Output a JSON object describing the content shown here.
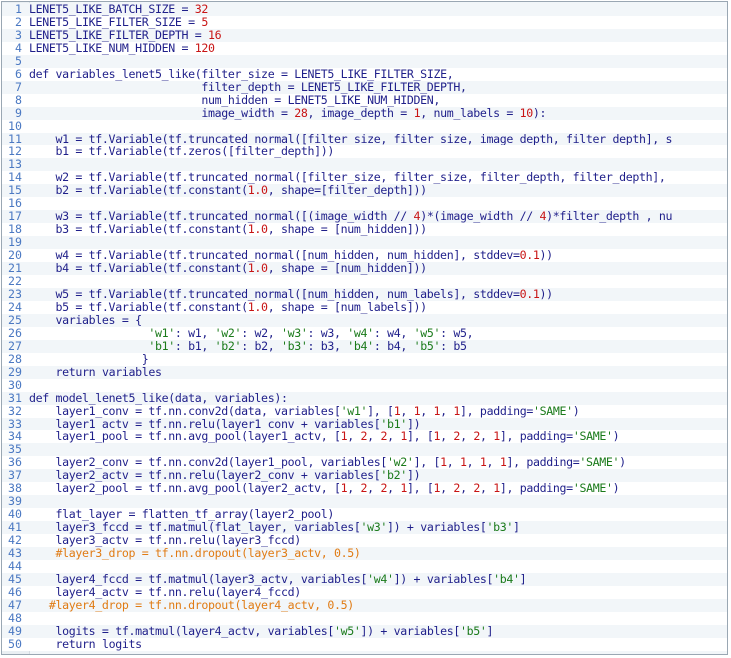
{
  "editor": {
    "lines": [
      {
        "n": "1",
        "tokens": [
          [
            "plain",
            "LENET5_LIKE_BATCH_SIZE = "
          ],
          [
            "num",
            "32"
          ]
        ]
      },
      {
        "n": "2",
        "tokens": [
          [
            "plain",
            "LENET5_LIKE_FILTER_SIZE = "
          ],
          [
            "num",
            "5"
          ]
        ]
      },
      {
        "n": "3",
        "tokens": [
          [
            "plain",
            "LENET5_LIKE_FILTER_DEPTH = "
          ],
          [
            "num",
            "16"
          ]
        ]
      },
      {
        "n": "4",
        "tokens": [
          [
            "plain",
            "LENET5_LIKE_NUM_HIDDEN = "
          ],
          [
            "num",
            "120"
          ]
        ]
      },
      {
        "n": "5",
        "tokens": []
      },
      {
        "n": "6",
        "tokens": [
          [
            "kw",
            "def "
          ],
          [
            "plain",
            "variables_lenet5_like(filter_size = LENET5_LIKE_FILTER_SIZE,"
          ]
        ]
      },
      {
        "n": "7",
        "tokens": [
          [
            "plain",
            "                          filter_depth = LENET5_LIKE_FILTER_DEPTH,"
          ]
        ]
      },
      {
        "n": "8",
        "tokens": [
          [
            "plain",
            "                          num_hidden = LENET5_LIKE_NUM_HIDDEN,"
          ]
        ]
      },
      {
        "n": "9",
        "tokens": [
          [
            "plain",
            "                          image_width = "
          ],
          [
            "num",
            "28"
          ],
          [
            "plain",
            ", image_depth = "
          ],
          [
            "num",
            "1"
          ],
          [
            "plain",
            ", num_labels = "
          ],
          [
            "num",
            "10"
          ],
          [
            "plain",
            "):"
          ]
        ]
      },
      {
        "n": "10",
        "tokens": []
      },
      {
        "n": "11",
        "tokens": [
          [
            "plain",
            "    w1 = tf.Variable(tf.truncated_normal([filter_size, filter_size, image_depth, filter_depth], s"
          ]
        ]
      },
      {
        "n": "12",
        "tokens": [
          [
            "plain",
            "    b1 = tf.Variable(tf.zeros([filter_depth]))"
          ]
        ]
      },
      {
        "n": "13",
        "tokens": []
      },
      {
        "n": "14",
        "tokens": [
          [
            "plain",
            "    w2 = tf.Variable(tf.truncated_normal([filter_size, filter_size, filter_depth, filter_depth], "
          ]
        ]
      },
      {
        "n": "15",
        "tokens": [
          [
            "plain",
            "    b2 = tf.Variable(tf.constant("
          ],
          [
            "num",
            "1.0"
          ],
          [
            "plain",
            ", shape=[filter_depth]))"
          ]
        ]
      },
      {
        "n": "16",
        "tokens": []
      },
      {
        "n": "17",
        "tokens": [
          [
            "plain",
            "    w3 = tf.Variable(tf.truncated_normal([(image_width // "
          ],
          [
            "num",
            "4"
          ],
          [
            "plain",
            ")*(image_width // "
          ],
          [
            "num",
            "4"
          ],
          [
            "plain",
            ")*filter_depth , nu"
          ]
        ]
      },
      {
        "n": "18",
        "tokens": [
          [
            "plain",
            "    b3 = tf.Variable(tf.constant("
          ],
          [
            "num",
            "1.0"
          ],
          [
            "plain",
            ", shape = [num_hidden]))"
          ]
        ]
      },
      {
        "n": "19",
        "tokens": []
      },
      {
        "n": "20",
        "tokens": [
          [
            "plain",
            "    w4 = tf.Variable(tf.truncated_normal([num_hidden, num_hidden], stddev="
          ],
          [
            "num",
            "0.1"
          ],
          [
            "plain",
            "))"
          ]
        ]
      },
      {
        "n": "21",
        "tokens": [
          [
            "plain",
            "    b4 = tf.Variable(tf.constant("
          ],
          [
            "num",
            "1.0"
          ],
          [
            "plain",
            ", shape = [num_hidden]))"
          ]
        ]
      },
      {
        "n": "22",
        "tokens": []
      },
      {
        "n": "23",
        "tokens": [
          [
            "plain",
            "    w5 = tf.Variable(tf.truncated_normal([num_hidden, num_labels], stddev="
          ],
          [
            "num",
            "0.1"
          ],
          [
            "plain",
            "))"
          ]
        ]
      },
      {
        "n": "24",
        "tokens": [
          [
            "plain",
            "    b5 = tf.Variable(tf.constant("
          ],
          [
            "num",
            "1.0"
          ],
          [
            "plain",
            ", shape = [num_labels]))"
          ]
        ]
      },
      {
        "n": "25",
        "tokens": [
          [
            "plain",
            "    variables = {"
          ]
        ]
      },
      {
        "n": "26",
        "tokens": [
          [
            "plain",
            "                  "
          ],
          [
            "str",
            "'w1'"
          ],
          [
            "plain",
            ": w1, "
          ],
          [
            "str",
            "'w2'"
          ],
          [
            "plain",
            ": w2, "
          ],
          [
            "str",
            "'w3'"
          ],
          [
            "plain",
            ": w3, "
          ],
          [
            "str",
            "'w4'"
          ],
          [
            "plain",
            ": w4, "
          ],
          [
            "str",
            "'w5'"
          ],
          [
            "plain",
            ": w5,"
          ]
        ]
      },
      {
        "n": "27",
        "tokens": [
          [
            "plain",
            "                  "
          ],
          [
            "str",
            "'b1'"
          ],
          [
            "plain",
            ": b1, "
          ],
          [
            "str",
            "'b2'"
          ],
          [
            "plain",
            ": b2, "
          ],
          [
            "str",
            "'b3'"
          ],
          [
            "plain",
            ": b3, "
          ],
          [
            "str",
            "'b4'"
          ],
          [
            "plain",
            ": b4, "
          ],
          [
            "str",
            "'b5'"
          ],
          [
            "plain",
            ": b5"
          ]
        ]
      },
      {
        "n": "28",
        "tokens": [
          [
            "plain",
            "                 }"
          ]
        ]
      },
      {
        "n": "29",
        "tokens": [
          [
            "plain",
            "    "
          ],
          [
            "kw",
            "return"
          ],
          [
            "plain",
            " variables"
          ]
        ]
      },
      {
        "n": "30",
        "tokens": []
      },
      {
        "n": "31",
        "tokens": [
          [
            "kw",
            "def "
          ],
          [
            "plain",
            "model_lenet5_like(data, variables):"
          ]
        ]
      },
      {
        "n": "32",
        "tokens": [
          [
            "plain",
            "    layer1_conv = tf.nn.conv2d(data, variables["
          ],
          [
            "str",
            "'w1'"
          ],
          [
            "plain",
            "], ["
          ],
          [
            "num",
            "1"
          ],
          [
            "plain",
            ", "
          ],
          [
            "num",
            "1"
          ],
          [
            "plain",
            ", "
          ],
          [
            "num",
            "1"
          ],
          [
            "plain",
            ", "
          ],
          [
            "num",
            "1"
          ],
          [
            "plain",
            "], padding="
          ],
          [
            "str",
            "'SAME'"
          ],
          [
            "plain",
            ")"
          ]
        ]
      },
      {
        "n": "33",
        "tokens": [
          [
            "plain",
            "    layer1_actv = tf.nn.relu(layer1_conv + variables["
          ],
          [
            "str",
            "'b1'"
          ],
          [
            "plain",
            "])"
          ]
        ]
      },
      {
        "n": "34",
        "tokens": [
          [
            "plain",
            "    layer1_pool = tf.nn.avg_pool(layer1_actv, ["
          ],
          [
            "num",
            "1"
          ],
          [
            "plain",
            ", "
          ],
          [
            "num",
            "2"
          ],
          [
            "plain",
            ", "
          ],
          [
            "num",
            "2"
          ],
          [
            "plain",
            ", "
          ],
          [
            "num",
            "1"
          ],
          [
            "plain",
            "], ["
          ],
          [
            "num",
            "1"
          ],
          [
            "plain",
            ", "
          ],
          [
            "num",
            "2"
          ],
          [
            "plain",
            ", "
          ],
          [
            "num",
            "2"
          ],
          [
            "plain",
            ", "
          ],
          [
            "num",
            "1"
          ],
          [
            "plain",
            "], padding="
          ],
          [
            "str",
            "'SAME'"
          ],
          [
            "plain",
            ")"
          ]
        ]
      },
      {
        "n": "35",
        "tokens": []
      },
      {
        "n": "36",
        "tokens": [
          [
            "plain",
            "    layer2_conv = tf.nn.conv2d(layer1_pool, variables["
          ],
          [
            "str",
            "'w2'"
          ],
          [
            "plain",
            "], ["
          ],
          [
            "num",
            "1"
          ],
          [
            "plain",
            ", "
          ],
          [
            "num",
            "1"
          ],
          [
            "plain",
            ", "
          ],
          [
            "num",
            "1"
          ],
          [
            "plain",
            ", "
          ],
          [
            "num",
            "1"
          ],
          [
            "plain",
            "], padding="
          ],
          [
            "str",
            "'SAME'"
          ],
          [
            "plain",
            ")"
          ]
        ]
      },
      {
        "n": "37",
        "tokens": [
          [
            "plain",
            "    layer2_actv = tf.nn.relu(layer2_conv + variables["
          ],
          [
            "str",
            "'b2'"
          ],
          [
            "plain",
            "])"
          ]
        ]
      },
      {
        "n": "38",
        "tokens": [
          [
            "plain",
            "    layer2_pool = tf.nn.avg_pool(layer2_actv, ["
          ],
          [
            "num",
            "1"
          ],
          [
            "plain",
            ", "
          ],
          [
            "num",
            "2"
          ],
          [
            "plain",
            ", "
          ],
          [
            "num",
            "2"
          ],
          [
            "plain",
            ", "
          ],
          [
            "num",
            "1"
          ],
          [
            "plain",
            "], ["
          ],
          [
            "num",
            "1"
          ],
          [
            "plain",
            ", "
          ],
          [
            "num",
            "2"
          ],
          [
            "plain",
            ", "
          ],
          [
            "num",
            "2"
          ],
          [
            "plain",
            ", "
          ],
          [
            "num",
            "1"
          ],
          [
            "plain",
            "], padding="
          ],
          [
            "str",
            "'SAME'"
          ],
          [
            "plain",
            ")"
          ]
        ]
      },
      {
        "n": "39",
        "tokens": []
      },
      {
        "n": "40",
        "tokens": [
          [
            "plain",
            "    flat_layer = flatten_tf_array(layer2_pool)"
          ]
        ]
      },
      {
        "n": "41",
        "tokens": [
          [
            "plain",
            "    layer3_fccd = tf.matmul(flat_layer, variables["
          ],
          [
            "str",
            "'w3'"
          ],
          [
            "plain",
            "]) + variables["
          ],
          [
            "str",
            "'b3'"
          ],
          [
            "plain",
            "]"
          ]
        ]
      },
      {
        "n": "42",
        "tokens": [
          [
            "plain",
            "    layer3_actv = tf.nn.relu(layer3_fccd)"
          ]
        ]
      },
      {
        "n": "43",
        "tokens": [
          [
            "cmt",
            "    #layer3_drop = tf.nn.dropout(layer3_actv, 0.5)"
          ]
        ]
      },
      {
        "n": "44",
        "tokens": []
      },
      {
        "n": "45",
        "tokens": [
          [
            "plain",
            "    layer4_fccd = tf.matmul(layer3_actv, variables["
          ],
          [
            "str",
            "'w4'"
          ],
          [
            "plain",
            "]) + variables["
          ],
          [
            "str",
            "'b4'"
          ],
          [
            "plain",
            "]"
          ]
        ]
      },
      {
        "n": "46",
        "tokens": [
          [
            "plain",
            "    layer4_actv = tf.nn.relu(layer4_fccd)"
          ]
        ]
      },
      {
        "n": "47",
        "tokens": [
          [
            "cmt",
            "   #layer4_drop = tf.nn.dropout(layer4_actv, 0.5)"
          ]
        ]
      },
      {
        "n": "48",
        "tokens": []
      },
      {
        "n": "49",
        "tokens": [
          [
            "plain",
            "    logits = tf.matmul(layer4_actv, variables["
          ],
          [
            "str",
            "'w5'"
          ],
          [
            "plain",
            "]) + variables["
          ],
          [
            "str",
            "'b5'"
          ],
          [
            "plain",
            "]"
          ]
        ]
      },
      {
        "n": "50",
        "tokens": [
          [
            "plain",
            "    "
          ],
          [
            "kw",
            "return"
          ],
          [
            "plain",
            " logits"
          ]
        ]
      }
    ]
  },
  "colors": {
    "line_number": "#4a78c2",
    "code_text": "#1f1f8a",
    "number_literal": "#c81414",
    "string_literal": "#1a7a1a",
    "comment": "#e07b14",
    "stripe_background": "#f2f6f9",
    "plain_background": "#ffffff"
  }
}
